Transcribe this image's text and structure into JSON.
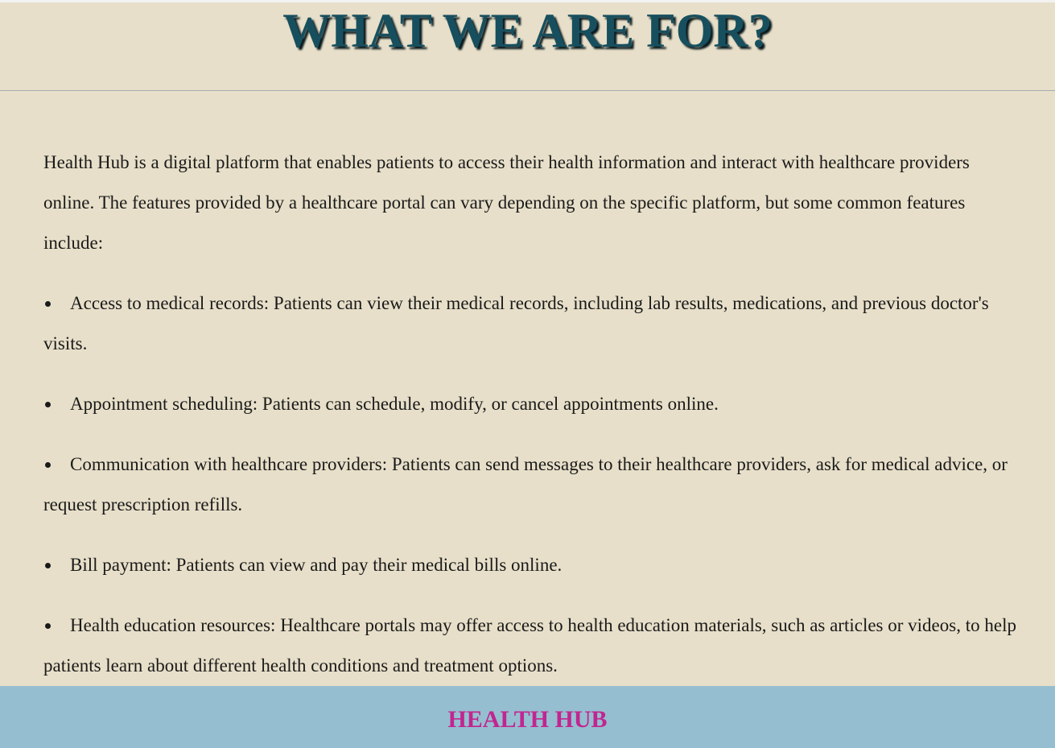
{
  "header": {
    "title": "WHAT WE ARE FOR?"
  },
  "main": {
    "intro": "Health Hub is a digital platform that enables patients to access their health information and interact with healthcare providers online. The features provided by a healthcare portal can vary depending on the specific platform, but some common features include:",
    "features": [
      "Access to medical records: Patients can view their medical records, including lab results, medications, and previous doctor's visits.",
      "Appointment scheduling: Patients can schedule, modify, or cancel appointments online.",
      "Communication with healthcare providers: Patients can send messages to their healthcare providers, ask for medical advice, or request prescription refills.",
      "Bill payment: Patients can view and pay their medical bills online.",
      "Health education resources: Healthcare portals may offer access to health education materials, such as articles or videos, to help patients learn about different health conditions and treatment options."
    ]
  },
  "footer": {
    "title": "HEALTH HUB"
  },
  "colors": {
    "background": "#e7dfc9",
    "title": "#174f5e",
    "footer_background": "#95bfd0",
    "footer_text": "#c12690"
  }
}
